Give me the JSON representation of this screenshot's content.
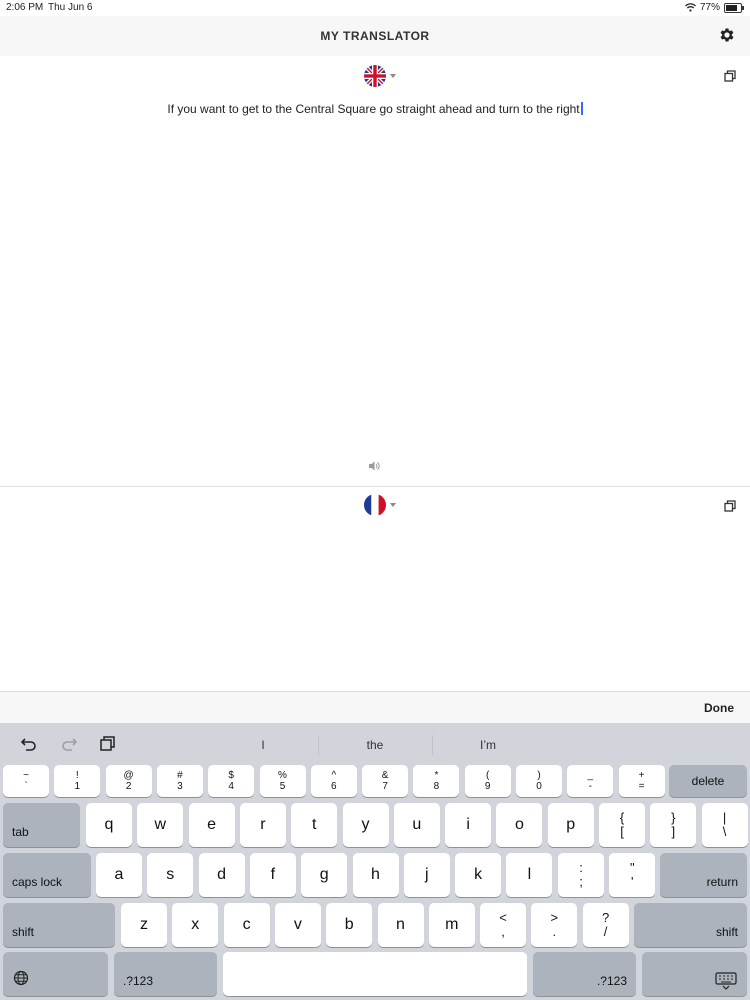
{
  "status": {
    "time": "2:06 PM",
    "date": "Thu Jun 6",
    "battery": "77%",
    "battery_level": 0.77
  },
  "nav": {
    "title": "MY TRANSLATOR"
  },
  "source": {
    "language_flag": "uk-flag-icon",
    "text": "If you want to get to the Central Square go straight ahead and turn to the right"
  },
  "target": {
    "language_flag": "france-flag-icon",
    "text": ""
  },
  "accessory": {
    "done": "Done"
  },
  "suggestions": [
    "I",
    "the",
    "I’m"
  ],
  "keyboard": {
    "number_row": [
      [
        "~",
        "`"
      ],
      [
        "!",
        "1"
      ],
      [
        "@",
        "2"
      ],
      [
        "#",
        "3"
      ],
      [
        "$",
        "4"
      ],
      [
        "%",
        "5"
      ],
      [
        "^",
        "6"
      ],
      [
        "&",
        "7"
      ],
      [
        "*",
        "8"
      ],
      [
        "(",
        "9"
      ],
      [
        ")",
        "0"
      ],
      [
        "_",
        "-"
      ],
      [
        "+",
        "="
      ]
    ],
    "row1": [
      "q",
      "w",
      "e",
      "r",
      "t",
      "y",
      "u",
      "i",
      "o",
      "p"
    ],
    "row1_extra": [
      [
        "{",
        "["
      ],
      [
        "}",
        "]"
      ],
      [
        "|",
        "\\"
      ]
    ],
    "row2": [
      "a",
      "s",
      "d",
      "f",
      "g",
      "h",
      "j",
      "k",
      "l"
    ],
    "row2_extra": [
      [
        ":",
        ";"
      ],
      [
        "\"",
        "'"
      ]
    ],
    "row3": [
      "z",
      "x",
      "c",
      "v",
      "b",
      "n",
      "m"
    ],
    "row3_extra": [
      [
        "<",
        ","
      ],
      [
        ">",
        "."
      ],
      [
        "?",
        "/"
      ]
    ],
    "delete": "delete",
    "tab": "tab",
    "caps": "caps lock",
    "return": "return",
    "shift": "shift",
    "numbers": ".?123"
  }
}
